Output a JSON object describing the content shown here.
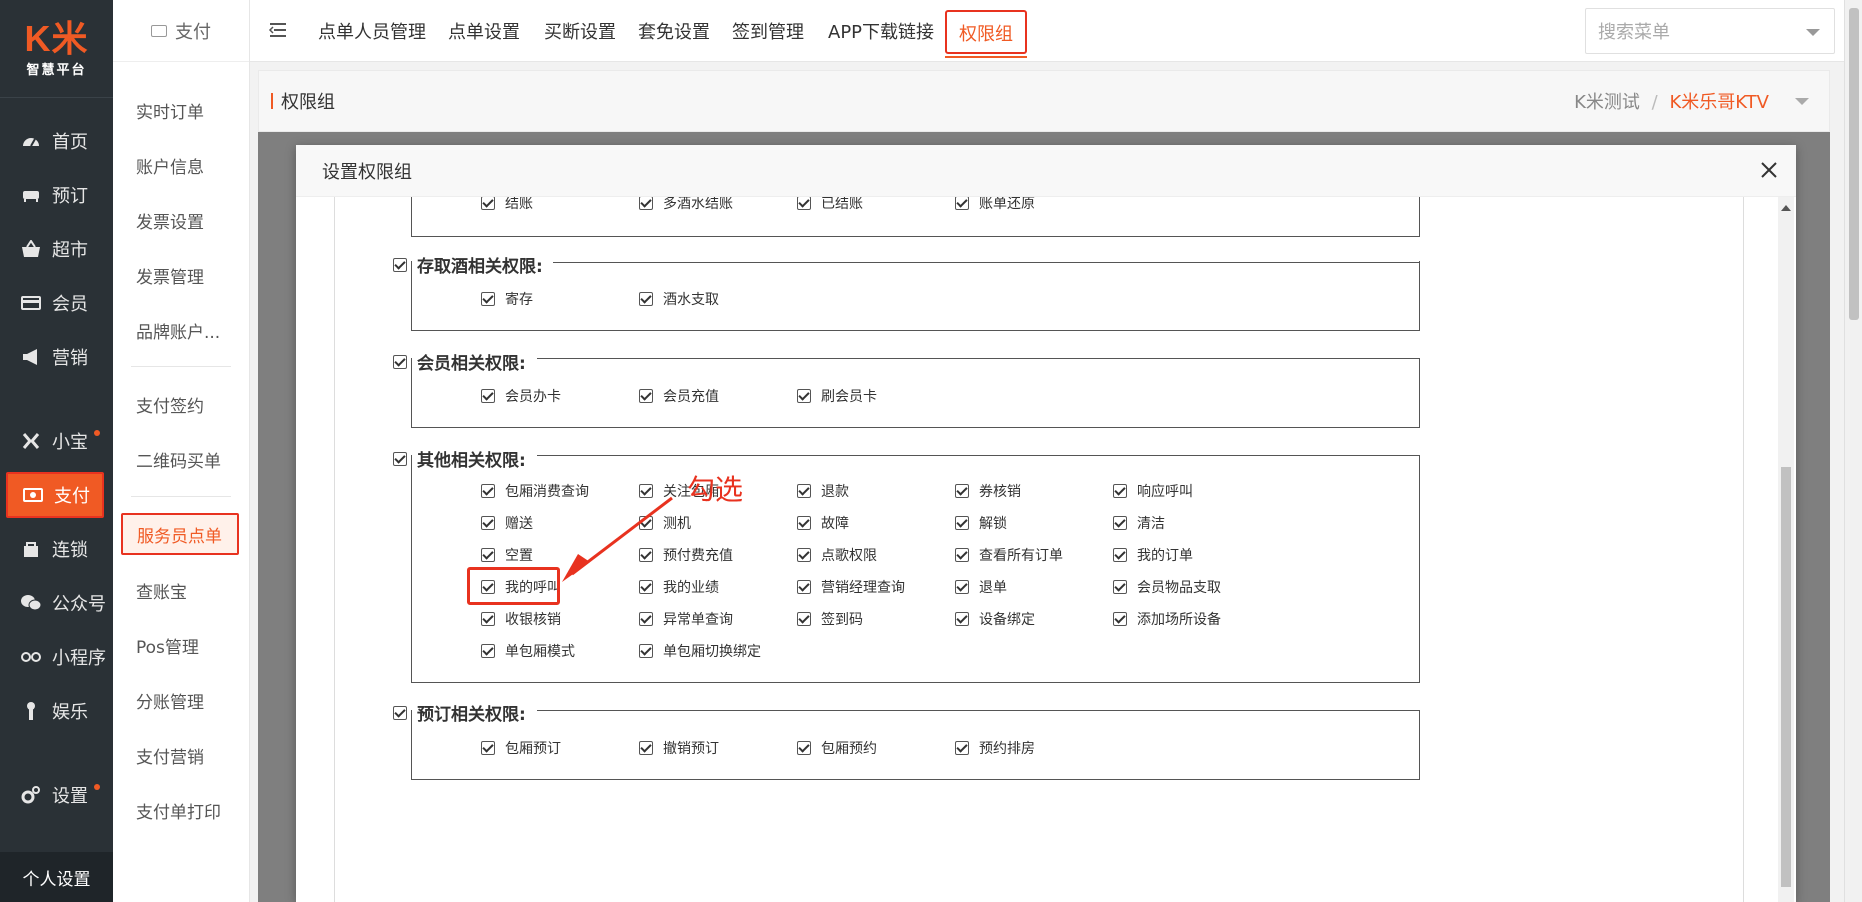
{
  "logo": {
    "mark": "K米",
    "sub": "智慧平台"
  },
  "left_nav": [
    {
      "label": "首页",
      "icon": "dashboard-icon"
    },
    {
      "label": "预订",
      "icon": "sofa-icon"
    },
    {
      "label": "超市",
      "icon": "basket-icon"
    },
    {
      "label": "会员",
      "icon": "card-icon"
    },
    {
      "label": "营销",
      "icon": "megaphone-icon"
    },
    {
      "label": "小宝",
      "icon": "xiaobao-icon"
    },
    {
      "label": "支付",
      "icon": "payment-icon"
    },
    {
      "label": "连锁",
      "icon": "store-icon"
    },
    {
      "label": "公众号",
      "icon": "wechat-icon"
    },
    {
      "label": "小程序",
      "icon": "miniprogram-icon"
    },
    {
      "label": "娱乐",
      "icon": "microphone-icon"
    },
    {
      "label": "设置",
      "icon": "gears-icon"
    }
  ],
  "personal_settings": "个人设置",
  "sub_nav": {
    "header": "支付",
    "items": [
      "实时订单",
      "账户信息",
      "发票设置",
      "发票管理",
      "品牌账户...",
      "支付签约",
      "二维码买单",
      "服务员点单",
      "查账宝",
      "Pos管理",
      "分账管理",
      "支付营销",
      "支付单打印"
    ]
  },
  "top_tabs": [
    "点单人员管理",
    "点单设置",
    "买断设置",
    "套免设置",
    "签到管理",
    "APP下载链接",
    "权限组"
  ],
  "search_placeholder": "搜索菜单",
  "breadcrumb": {
    "title": "权限组",
    "org": "K米测试",
    "sep": "/",
    "store": "K米乐哥KTV"
  },
  "modal": {
    "title": "设置权限组",
    "top_partial": [
      "结账",
      "多酒水结账",
      "已结账",
      "账单还原"
    ],
    "groups": [
      {
        "title": "存取酒相关权限:",
        "options": [
          "寄存",
          "酒水支取"
        ]
      },
      {
        "title": "会员相关权限:",
        "options": [
          "会员办卡",
          "会员充值",
          "刷会员卡"
        ]
      },
      {
        "title": "其他相关权限:",
        "options": [
          "包厢消费查询",
          "关注包厢",
          "退款",
          "券核销",
          "响应呼叫",
          "赠送",
          "测机",
          "故障",
          "解锁",
          "清洁",
          "空置",
          "预付费充值",
          "点歌权限",
          "查看所有订单",
          "我的订单",
          "我的呼叫",
          "我的业绩",
          "营销经理查询",
          "退单",
          "会员物品支取",
          "收银核销",
          "异常单查询",
          "签到码",
          "设备绑定",
          "添加场所设备",
          "单包厢模式",
          "单包厢切换绑定"
        ]
      },
      {
        "title": "预订相关权限:",
        "options": [
          "包厢预订",
          "撤销预订",
          "包厢预约",
          "预约排房"
        ]
      }
    ]
  },
  "annotation": "勾选",
  "colors": {
    "brand": "#f05a24",
    "highlight": "#e8321f",
    "sidebar": "#2a3136"
  }
}
